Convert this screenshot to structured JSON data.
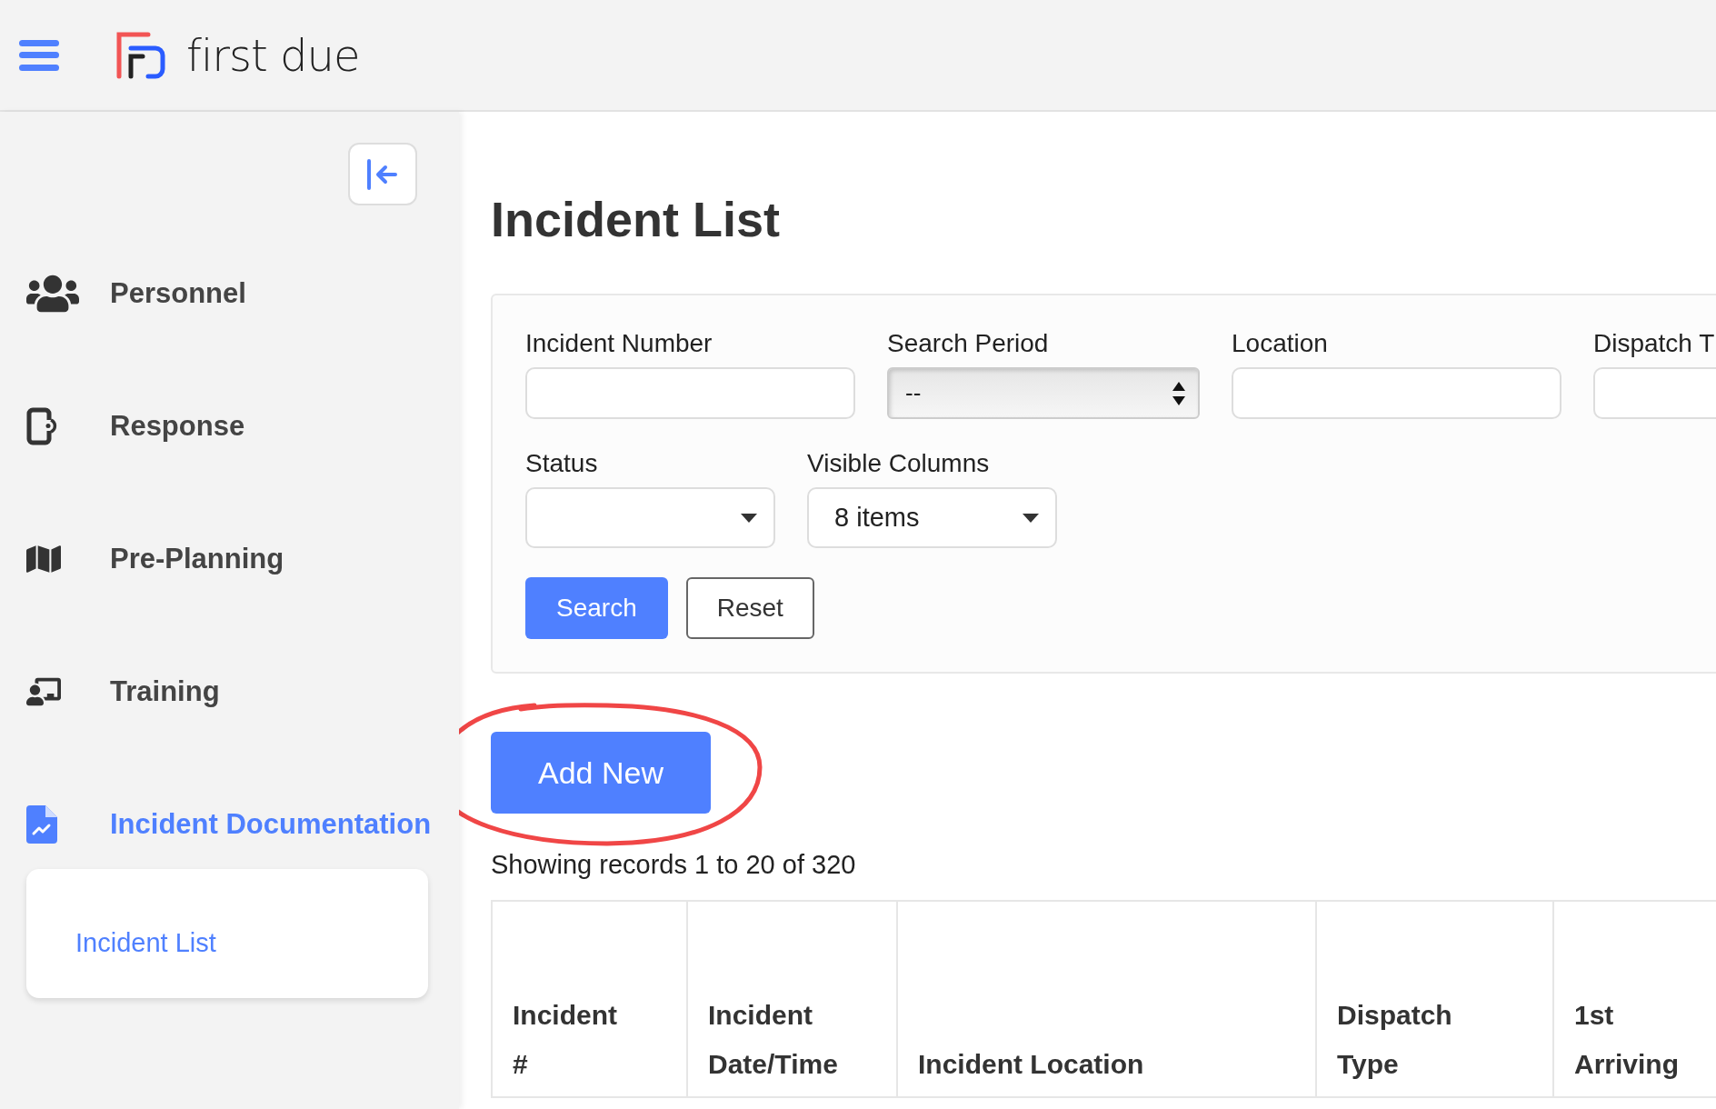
{
  "header": {
    "brand": "first due"
  },
  "sidebar": {
    "items": [
      {
        "label": "Personnel",
        "selected": false
      },
      {
        "label": "Response",
        "selected": false
      },
      {
        "label": "Pre-Planning",
        "selected": false
      },
      {
        "label": "Training",
        "selected": false
      },
      {
        "label": "Incident Documentation",
        "selected": true,
        "children": [
          {
            "label": "Incident List",
            "selected": true
          }
        ]
      }
    ]
  },
  "page": {
    "title": "Incident List"
  },
  "filters": {
    "rows": [
      {
        "fields": [
          {
            "label": "Incident Number",
            "kind": "text"
          },
          {
            "label": "Search Period",
            "kind": "native-select",
            "value": "--"
          },
          {
            "label": "Location",
            "kind": "text"
          },
          {
            "label": "Dispatch T",
            "kind": "text"
          }
        ]
      },
      {
        "fields": [
          {
            "label": "Status",
            "kind": "dropdown"
          },
          {
            "label": "Visible Columns",
            "kind": "dropdown",
            "value": "8 items"
          }
        ]
      }
    ],
    "buttons": [
      {
        "label": "Search",
        "kind": "primary"
      },
      {
        "label": "Reset",
        "kind": "secondary"
      }
    ]
  },
  "add_button": "Add New",
  "records_text": "Showing records 1 to 20 of 320",
  "table": {
    "columns": [
      {
        "lines": [
          "Incident",
          "#"
        ]
      },
      {
        "lines": [
          "Incident",
          "Date/Time"
        ]
      },
      {
        "lines": [
          "Incident Location"
        ]
      },
      {
        "lines": [
          "Dispatch",
          "Type"
        ]
      },
      {
        "lines": [
          "1st",
          "Arriving"
        ]
      }
    ]
  }
}
